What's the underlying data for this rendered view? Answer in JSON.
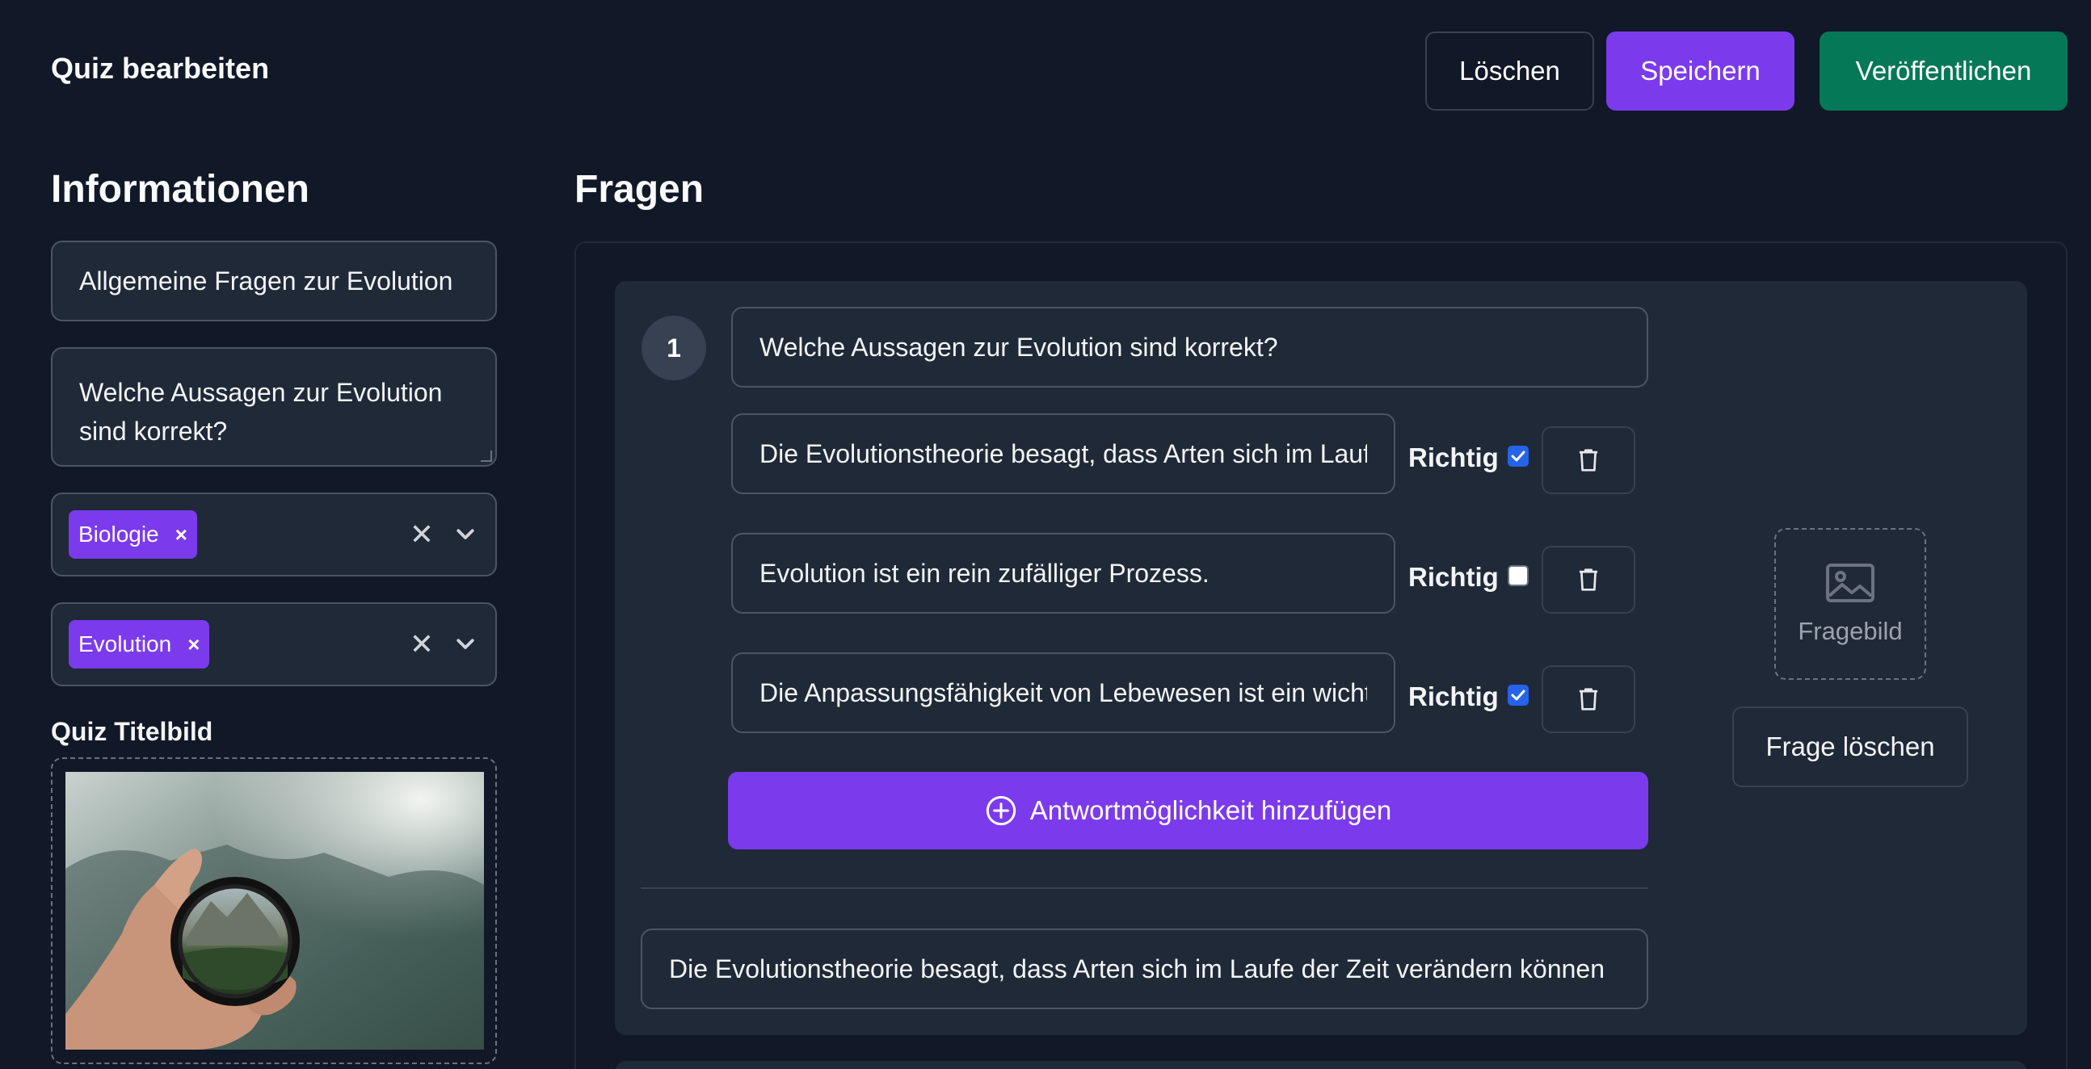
{
  "header": {
    "title": "Quiz bearbeiten",
    "delete_label": "Löschen",
    "save_label": "Speichern",
    "publish_label": "Veröffentlichen"
  },
  "info": {
    "heading": "Informationen",
    "title_value": "Allgemeine Fragen zur Evolution",
    "description_value": "Welche Aussagen zur Evolution sind korrekt?",
    "category_chip": "Biologie",
    "tag_chip": "Evolution",
    "cover_label": "Quiz Titelbild"
  },
  "questions": {
    "heading": "Fragen",
    "items": [
      {
        "number": "1",
        "text": "Welche Aussagen zur Evolution sind korrekt?",
        "correct_label": "Richtig",
        "answers": [
          {
            "text": "Die Evolutionstheorie besagt, dass Arten sich im Laufe der Zeit verändern können",
            "correct": true
          },
          {
            "text": "Evolution ist ein rein zufälliger Prozess.",
            "correct": false
          },
          {
            "text": "Die Anpassungsfähigkeit von Lebewesen ist ein wichtiger Faktor der Evolution",
            "correct": true
          }
        ],
        "add_answer_label": "Antwortmöglichkeit hinzufügen",
        "explanation": "Die Evolutionstheorie besagt, dass Arten sich im Laufe der Zeit verändern können",
        "image_label": "Fragebild",
        "delete_label": "Frage löschen"
      }
    ]
  },
  "colors": {
    "background": "#111827",
    "panel": "#1f2937",
    "accent": "#7c3aed",
    "publish": "#047857",
    "checkbox": "#2563eb"
  }
}
